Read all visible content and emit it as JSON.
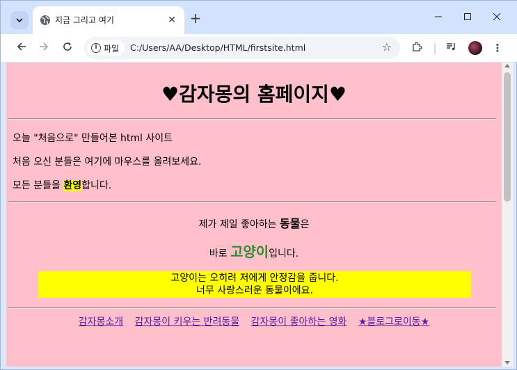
{
  "browser": {
    "tab_title": "지금 그리고 여기",
    "tab_close": "✕",
    "new_tab": "+",
    "site_chip_label": "파일",
    "url": "C:/Users/AA/Desktop/HTML/firstsite.html"
  },
  "page": {
    "title": "♥감자몽의 홈페이지♥",
    "intro": {
      "line1": "오늘 \"처음으로\" 만들어본 html 사이트",
      "line2": "처음 오신 분들은 여기에 마우스를 올려보세요.",
      "line3_before": "모든 분들을 ",
      "line3_highlight": "환영",
      "line3_after": "합니다."
    },
    "animal": {
      "line1_before": "제가 제일 좋아하는 ",
      "line1_bold": "동물",
      "line1_after": "은",
      "line2_before": "바로 ",
      "line2_green": "고양이",
      "line2_after": "입니다.",
      "box_line1": "고양이는 오히려 저에게 안정감을 줍니다.",
      "box_line2": "너무 사랑스러운 동물이에요."
    },
    "links": [
      "감자몽소개",
      "감자몽이 키우는 반려동물",
      "감자몽이 좋아하는 영화",
      "★블로그로이동★"
    ]
  },
  "colors": {
    "page_bg": "#ffc0cb",
    "highlight": "#ffff00",
    "green_text": "#2e8b2e",
    "link": "#5a1aa0"
  }
}
